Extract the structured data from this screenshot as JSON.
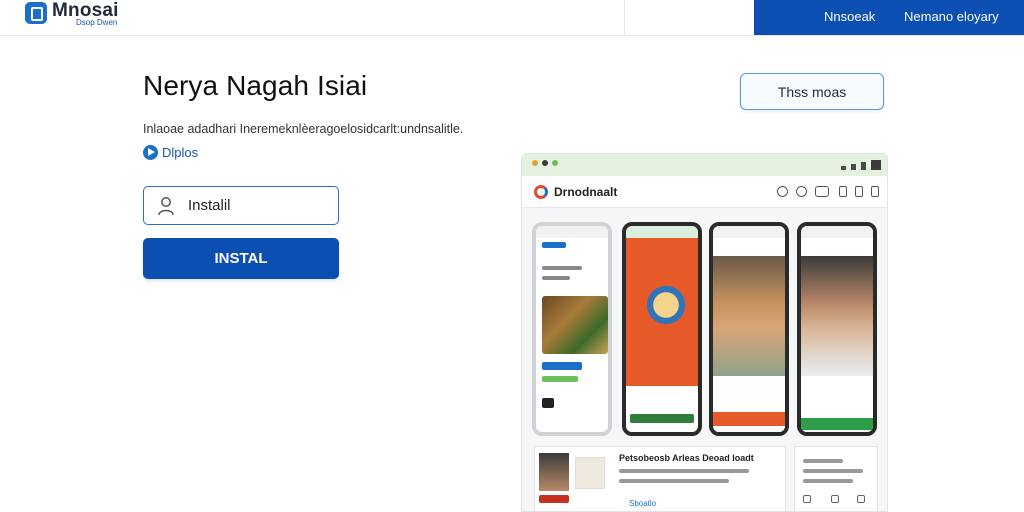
{
  "topbar": {
    "brand": "Mnosai",
    "brand_sub": "Dsop Dwen",
    "link_1": "Nnsoeak",
    "link_2": "Nemano eloyary"
  },
  "main": {
    "title": "Nerya Nagah Isiai",
    "subtitle": "Inlaoae adadhari Ineremeknlèeragoelosidcarlt:undnsalitle.",
    "link": "Dlplos",
    "input_value": "Instalil",
    "install_button": "INSTAL",
    "outline_button": "Thss moas"
  },
  "preview": {
    "app_title": "Drnodnaalt",
    "card_title": "Petsobeosb Arleas Deoad Ioadt",
    "card_link": "Sboatlo",
    "colors": {
      "accent": "#0b4fb3",
      "orange": "#e65a2a",
      "green": "#2f9d48"
    }
  }
}
